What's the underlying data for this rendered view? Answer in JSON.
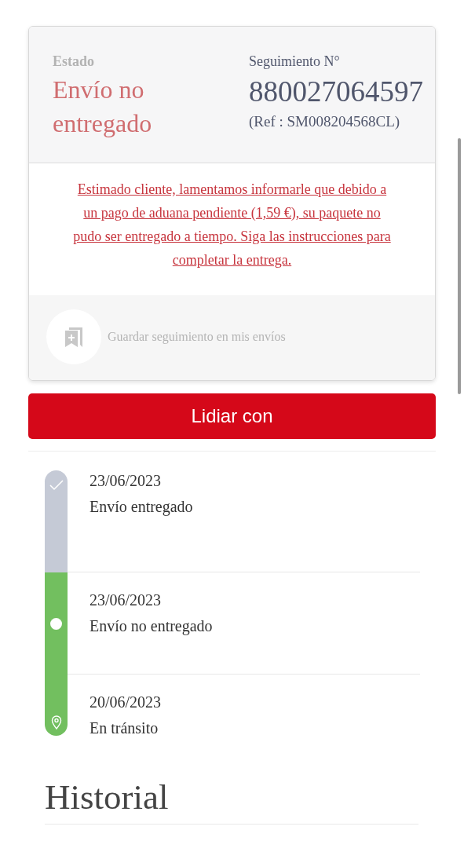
{
  "status": {
    "label": "Estado",
    "value": "Envío no entregado"
  },
  "tracking": {
    "label": "Seguimiento N°",
    "number": "880027064597",
    "ref": "(Ref : SM008204568CL)"
  },
  "message": "Estimado cliente, lamentamos informarle que debido a un pago de aduana pendiente (1,59 €), su paquete no pudo ser entregado a tiempo. Siga las instrucciones para completar la entrega.",
  "save": {
    "label": "Guardar seguimiento en mis envíos",
    "disabled": true
  },
  "action_button": "Lidiar con",
  "timeline": [
    {
      "kind": "check",
      "color": "#c5cad6",
      "date": "23/06/2023",
      "event": "Envío entregado"
    },
    {
      "kind": "dot",
      "color": "#72bf5f",
      "date": "23/06/2023",
      "event": "Envío no entregado"
    },
    {
      "kind": "pin",
      "color": "#72bf5f",
      "date": "20/06/2023",
      "event": "En tránsito"
    }
  ],
  "history_title": "Historial"
}
